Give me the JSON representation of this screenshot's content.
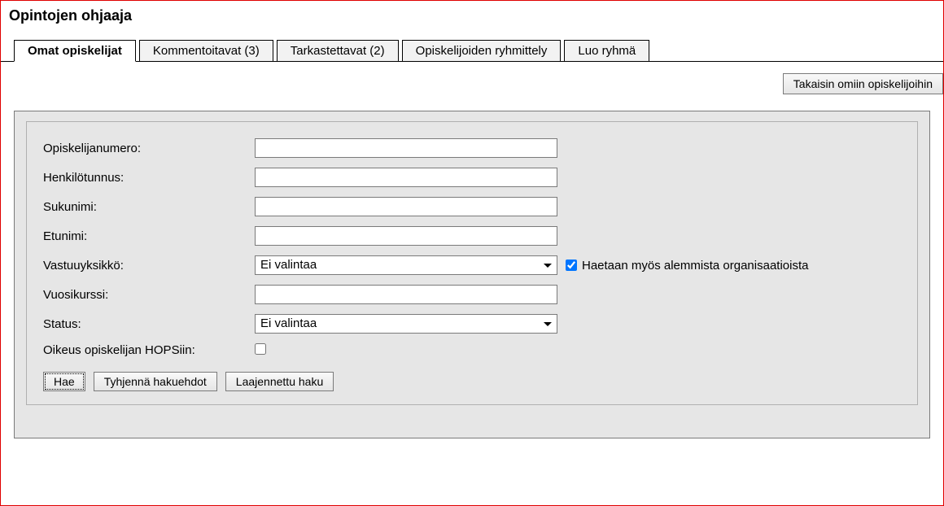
{
  "page": {
    "title": "Opintojen ohjaaja"
  },
  "tabs": [
    {
      "label": "Omat opiskelijat",
      "active": true
    },
    {
      "label": "Kommentoitavat (3)",
      "active": false
    },
    {
      "label": "Tarkastettavat (2)",
      "active": false
    },
    {
      "label": "Opiskelijoiden ryhmittely",
      "active": false
    },
    {
      "label": "Luo ryhmä",
      "active": false
    }
  ],
  "topbar": {
    "back_button": "Takaisin omiin opiskelijoihin"
  },
  "form": {
    "student_number_label": "Opiskelijanumero:",
    "student_number_value": "",
    "personal_id_label": "Henkilötunnus:",
    "personal_id_value": "",
    "lastname_label": "Sukunimi:",
    "lastname_value": "",
    "firstname_label": "Etunimi:",
    "firstname_value": "",
    "unit_label": "Vastuuyksikkö:",
    "unit_selected": "Ei valintaa",
    "suborg_checkbox_label": "Haetaan myös alemmista organisaatioista",
    "suborg_checked": true,
    "year_label": "Vuosikurssi:",
    "year_value": "",
    "status_label": "Status:",
    "status_selected": "Ei valintaa",
    "hops_right_label": "Oikeus opiskelijan HOPSiin:",
    "hops_right_checked": false
  },
  "buttons": {
    "search": "Hae",
    "clear": "Tyhjennä hakuehdot",
    "advanced": "Laajennettu haku"
  }
}
